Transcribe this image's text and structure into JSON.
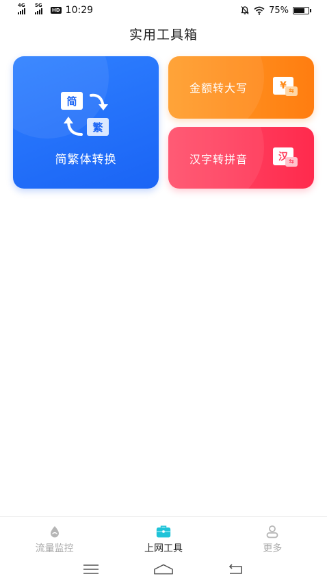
{
  "status_bar": {
    "network_1": "4G",
    "network_2": "5G",
    "hd": "HD",
    "time": "10:29",
    "battery": "75%",
    "battery_level": 0.75
  },
  "header": {
    "title": "实用工具箱"
  },
  "tools": {
    "convert": {
      "label": "简繁体转换",
      "simp_char": "简",
      "trad_char": "繁",
      "color": "#1a64f5"
    },
    "amount": {
      "label": "金额转大写",
      "icon_char": "¥",
      "badge": "⇆",
      "color": "#ff8a18"
    },
    "pinyin": {
      "label": "汉字转拼音",
      "icon_char": "汉",
      "badge": "⇆",
      "color": "#ff3a5a"
    }
  },
  "tabbar": {
    "items": [
      {
        "label": "流量监控",
        "icon": "water-drop-icon",
        "active": false
      },
      {
        "label": "上网工具",
        "icon": "toolbox-icon",
        "active": true
      },
      {
        "label": "更多",
        "icon": "person-icon",
        "active": false
      }
    ],
    "active_color": "#1fc3d8"
  },
  "navbar": {
    "icons": [
      "menu-icon",
      "home-icon",
      "back-icon"
    ]
  }
}
